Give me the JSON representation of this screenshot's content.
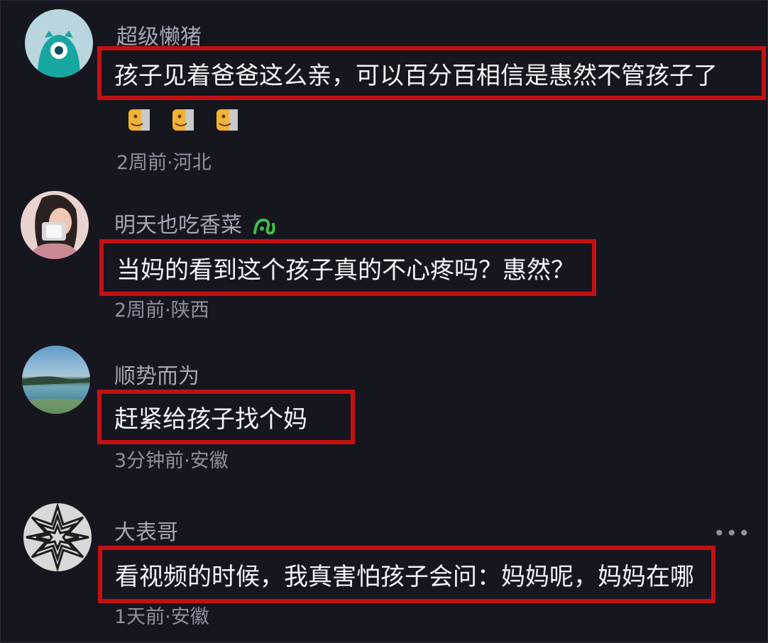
{
  "comments": [
    {
      "username": "超级懒猪",
      "text": "孩子见着爸爸这么亲，可以百分百相信是惠然不管孩子了",
      "meta": "2周前·河北"
    },
    {
      "username": "明天也吃香菜",
      "text": "当妈的看到这个孩子真的不心疼吗？惠然？",
      "meta": "2周前·陕西"
    },
    {
      "username": "顺势而为",
      "text": "赶紧给孩子找个妈",
      "meta": "3分钟前·安徽"
    },
    {
      "username": "大表哥",
      "text": "看视频的时候，我真害怕孩子会问：妈妈呢，妈妈在哪",
      "meta": "1天前·安徽"
    }
  ],
  "icons": {
    "emoji": "wink-emoji-icon",
    "badge": "green-badge-icon",
    "more": "more-icon"
  },
  "colors": {
    "background": "#16161f",
    "highlight_border": "#c41012",
    "username": "#a5a7b6",
    "meta": "#8f91a0",
    "body": "#f4f4f8"
  }
}
